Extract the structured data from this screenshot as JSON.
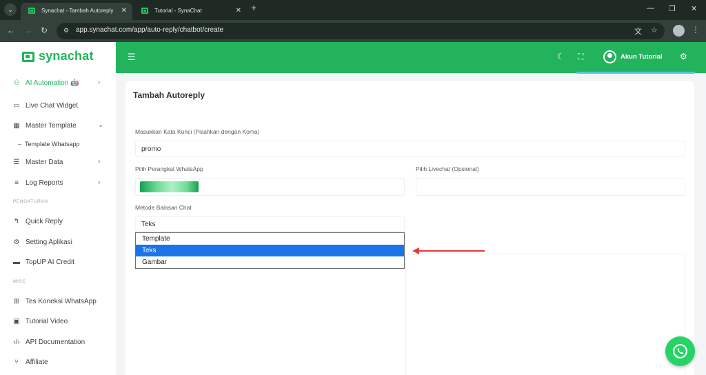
{
  "browser": {
    "tabs": [
      {
        "title": "Synachat - Tambah Autoreply"
      },
      {
        "title": "Tutorial - SynaChat"
      }
    ],
    "url": "app.synachat.com/app/auto-reply/chatbot/create"
  },
  "brand": {
    "name": "synachat",
    "color": "#1fb55a"
  },
  "sidebar": {
    "items": [
      {
        "label": "AI Automation 🤖",
        "icon": "robot-icon"
      },
      {
        "label": "Live Chat Widget",
        "icon": "chat-icon"
      },
      {
        "label": "Master Template",
        "icon": "template-icon"
      },
      {
        "label": "Template Whatsapp"
      },
      {
        "label": "Master Data",
        "icon": "list-icon"
      },
      {
        "label": "Log Reports",
        "icon": "report-icon"
      },
      {
        "label": "Quick Reply",
        "icon": "reply-icon"
      },
      {
        "label": "Setting Aplikasi",
        "icon": "gear-icon"
      },
      {
        "label": "TopUP AI Credit",
        "icon": "credit-card-icon"
      },
      {
        "label": "Tes Koneksi WhatsApp",
        "icon": "connection-icon"
      },
      {
        "label": "Tutorial Video",
        "icon": "video-icon"
      },
      {
        "label": "API Documentation",
        "icon": "code-icon"
      },
      {
        "label": "Affiliate",
        "icon": "affiliate-icon"
      }
    ],
    "sections": {
      "pengaturan": "PENGATURAN",
      "misc": "MISC"
    }
  },
  "header": {
    "user": "Akun Tutorial",
    "accent": "#22b35c"
  },
  "form": {
    "title": "Tambah Autoreply",
    "keyword_label": "Masukkan Kata Kunci (Pisahkan dengan Koma)",
    "keyword_value": "promo",
    "device_label": "Pilih Perangkat WhatsApp",
    "livechat_label": "Pilih Livechat (Opsional)",
    "method_label": "Metode Balasan Chat",
    "method_value": "Teks",
    "method_options": [
      "Template",
      "Teks",
      "Gambar"
    ],
    "selected_option_color": "#1a73e8"
  },
  "annotation": {
    "arrow_color": "#e53935"
  }
}
